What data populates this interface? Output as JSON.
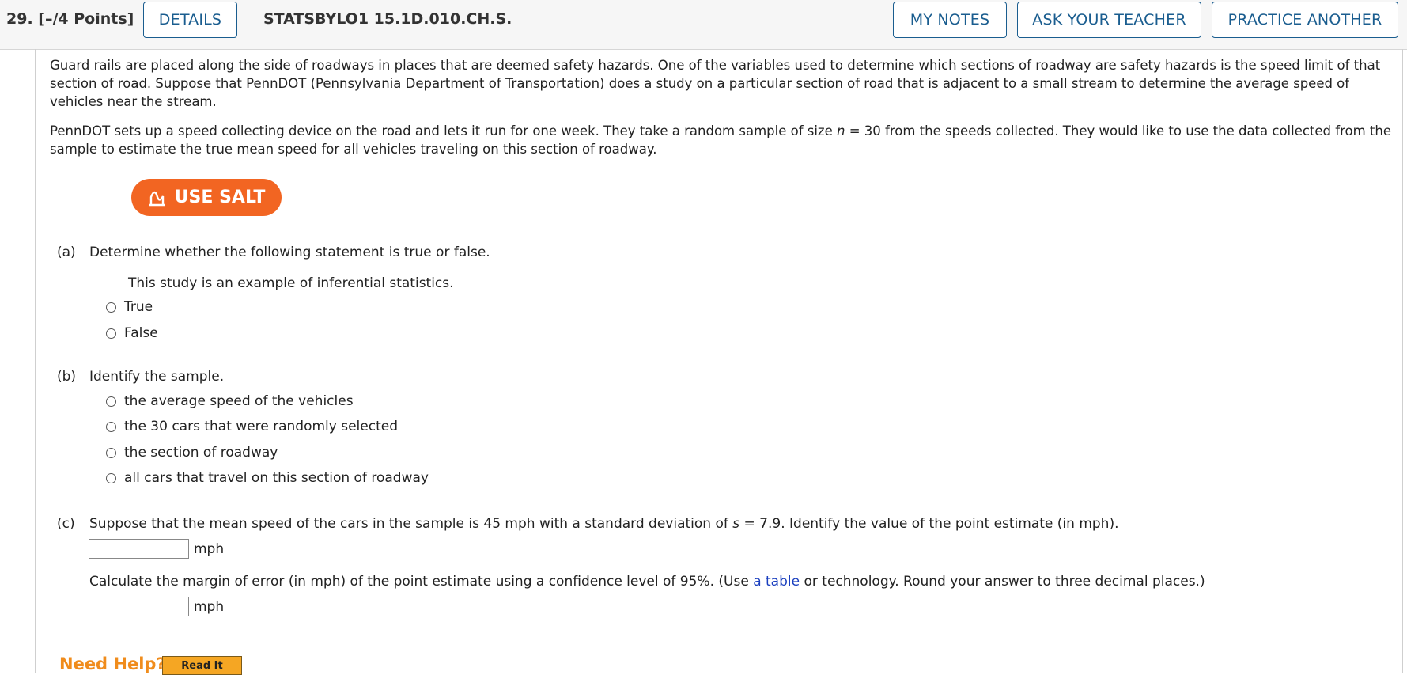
{
  "header": {
    "question_number": "29. [–/4 Points]",
    "details_label": "DETAILS",
    "question_code": "STATSBYLO1 15.1D.010.CH.S.",
    "my_notes_label": "MY NOTES",
    "ask_teacher_label": "ASK YOUR TEACHER",
    "practice_another_label": "PRACTICE ANOTHER"
  },
  "intro": {
    "paragraph1": "Guard rails are placed along the side of roadways in places that are deemed safety hazards. One of the variables used to determine which sections of roadway are safety hazards is the speed limit of that section of road. Suppose that PennDOT (Pennsylvania Department of Transportation) does a study on a particular section of road that is adjacent to a small stream to determine the average speed of vehicles near the stream.",
    "paragraph2_before": "PennDOT sets up a speed collecting device on the road and lets it run for one week. They take a random sample of size ",
    "paragraph2_var": "n",
    "paragraph2_after": " = 30 from the speeds collected. They would like to use the data collected from the sample to estimate the true mean speed for all vehicles traveling on this section of roadway."
  },
  "salt_button_label": "USE SALT",
  "part_a": {
    "label": "(a)",
    "prompt": "Determine whether the following statement is true or false.",
    "statement": "This study is an example of inferential statistics.",
    "options": [
      "True",
      "False"
    ]
  },
  "part_b": {
    "label": "(b)",
    "prompt": "Identify the sample.",
    "options": [
      "the average speed of the vehicles",
      "the 30 cars that were randomly selected",
      "the section of roadway",
      "all cars that travel on this section of roadway"
    ]
  },
  "part_c": {
    "label": "(c)",
    "prompt_before": "Suppose that the mean speed of the cars in the sample is 45 mph with a standard deviation of ",
    "prompt_var": "s",
    "prompt_after": " = 7.9. Identify the value of the point estimate (in mph).",
    "unit1": "mph",
    "margin_before": "Calculate the margin of error (in mph) of the point estimate using a confidence level of 95%. (Use ",
    "margin_link": "a table",
    "margin_after": " or technology. Round your answer to three decimal places.)",
    "unit2": "mph",
    "answer1_value": "",
    "answer2_value": ""
  },
  "help": {
    "need_help_label": "Need Help?",
    "read_it_label": "Read It"
  },
  "colors": {
    "accent": "#1a5d8f",
    "salt": "#f26522",
    "need_help": "#f08c1c",
    "read_it": "#f5a623",
    "link": "#1a3fbf"
  }
}
